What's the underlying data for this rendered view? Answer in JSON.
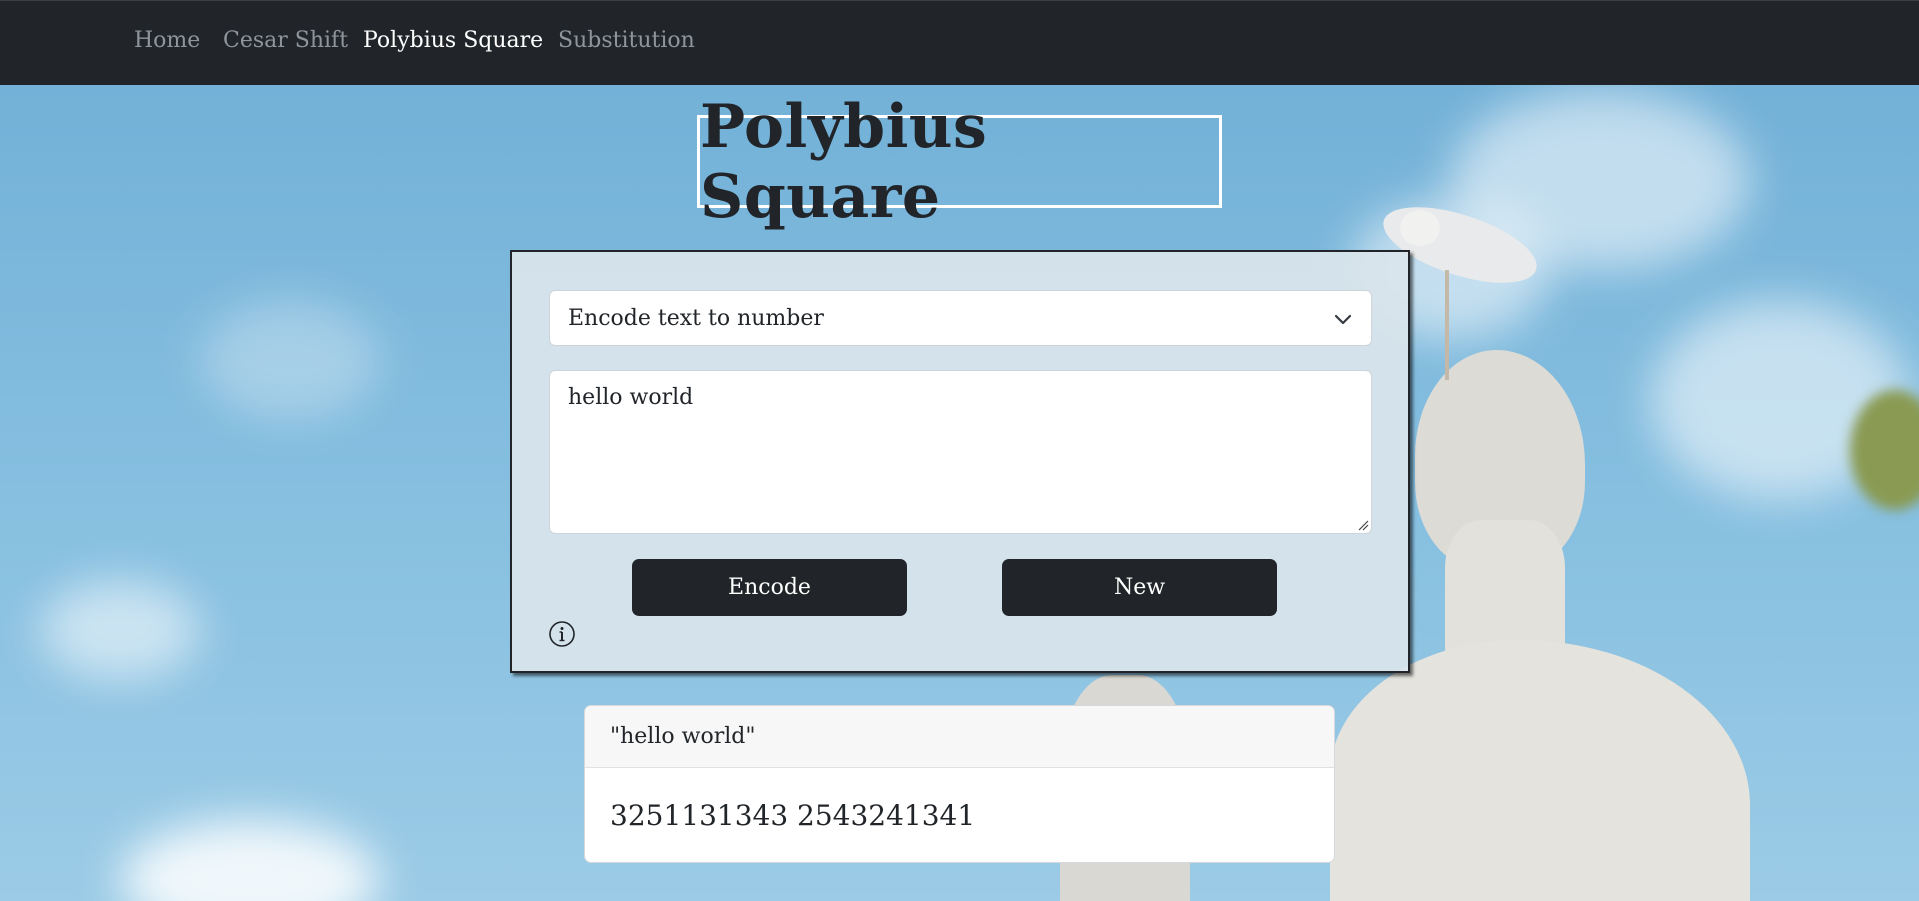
{
  "nav": {
    "items": [
      {
        "label": "Home",
        "active": false
      },
      {
        "label": "Cesar Shift",
        "active": false
      },
      {
        "label": "Polybius Square",
        "active": true
      },
      {
        "label": "Substitution",
        "active": false
      }
    ]
  },
  "page": {
    "title": "Polybius Square"
  },
  "form": {
    "mode_selected": "Encode text to number",
    "input_value": "hello world",
    "encode_label": "Encode",
    "new_label": "New"
  },
  "result": {
    "header": "\"hello world\"",
    "output": "3251131343 2543241341"
  },
  "icons": {
    "info": "info-circle-icon",
    "dropdown": "chevron-down-icon"
  },
  "colors": {
    "navbar": "#212529",
    "button": "#212529",
    "sky": "#7bb7dc"
  }
}
